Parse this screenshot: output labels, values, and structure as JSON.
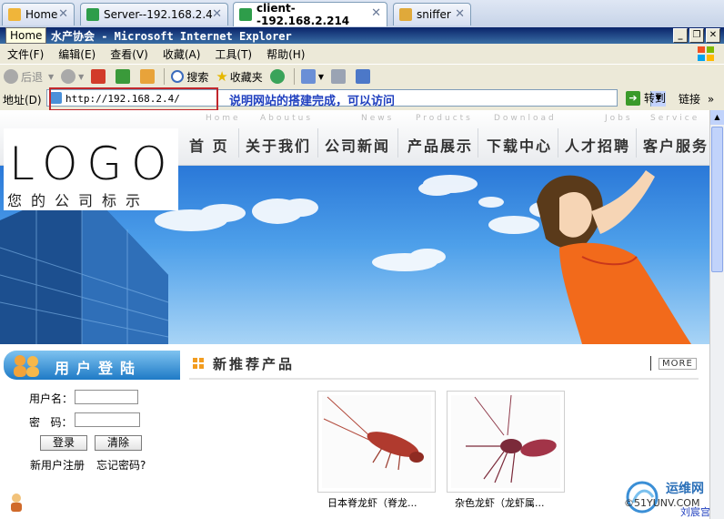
{
  "browser": {
    "tabs": [
      {
        "label": "Home",
        "active": false
      },
      {
        "label": "Server--192.168.2.4",
        "active": false
      },
      {
        "label": "client--192.168.2.214",
        "active": true
      },
      {
        "label": "sniffer",
        "active": false
      }
    ],
    "tab_close": "✕",
    "tooltip": "Home",
    "window_title": "水产协会 - Microsoft Internet Explorer",
    "window_buttons": [
      "_",
      "❐",
      "✕"
    ],
    "menu": [
      "文件(F)",
      "编辑(E)",
      "查看(V)",
      "收藏(A)",
      "工具(T)",
      "帮助(H)"
    ],
    "toolbar": {
      "back": "后退",
      "search": "搜索",
      "favorites": "收藏夹"
    },
    "address": {
      "label": "地址(D)",
      "url": "http://192.168.2.4/",
      "go": "转到",
      "links": "链接",
      "links_arrow": "»"
    },
    "annotation": "说明网站的搭建完成，可以访问",
    "accent": "#0a246a"
  },
  "site": {
    "logo_text": "LOGO",
    "logo_sub": "您的公司标示",
    "nav": [
      {
        "label": "首 页",
        "sub": "Home"
      },
      {
        "label": "关于我们",
        "sub": "Aboutus"
      },
      {
        "label": "公司新闻",
        "sub": "News"
      },
      {
        "label": "产品展示",
        "sub": "Products"
      },
      {
        "label": "下载中心",
        "sub": "Download"
      },
      {
        "label": "人才招聘",
        "sub": "Jobs"
      },
      {
        "label": "客户服务",
        "sub": "Service"
      }
    ],
    "login": {
      "title": "用户登陆",
      "username_label": "用户名：",
      "password_label": "密   码：",
      "login_button": "登录",
      "clear_button": "清除",
      "register_link": "新用户注册",
      "forgot_link": "忘记密码?"
    },
    "products": {
      "title": "新推荐产品",
      "more": "MORE",
      "items": [
        {
          "caption": "日本脊龙虾（脊龙..."
        },
        {
          "caption": "杂色龙虾（龙虾属..."
        }
      ]
    }
  },
  "watermark": {
    "line1": "运维网",
    "line2": "©51YUNV.COM",
    "author": "刘宸宫"
  }
}
